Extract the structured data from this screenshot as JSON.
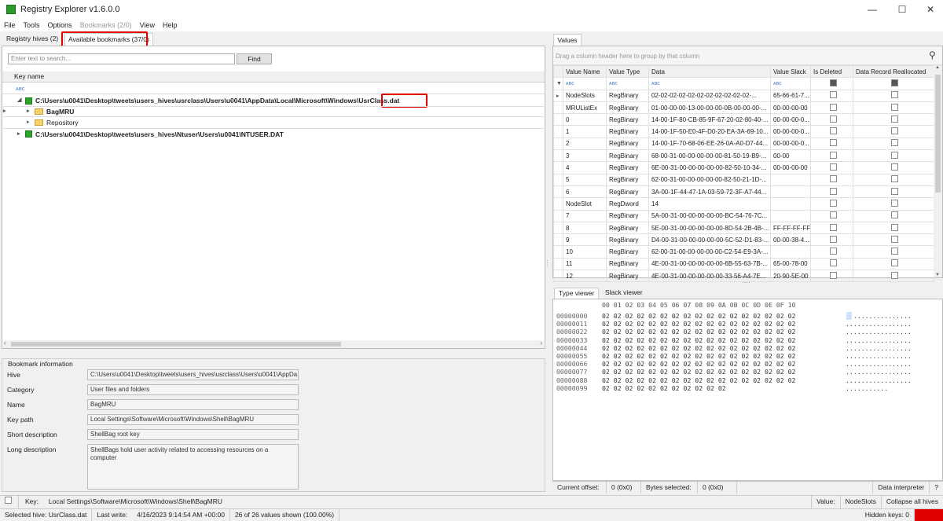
{
  "window": {
    "title": "Registry Explorer v1.6.0.0",
    "min": "—",
    "max": "☐",
    "close": "✕"
  },
  "menu": [
    "File",
    "Tools",
    "Options",
    "Bookmarks (2/0)",
    "View",
    "Help"
  ],
  "left_tabs": {
    "hives": "Registry hives (2)",
    "bookmarks": "Available bookmarks (37/0)"
  },
  "search": {
    "placeholder": "Enter text to search...",
    "find": "Find"
  },
  "tree": {
    "header": "Key name",
    "filter": "ᴀʙc",
    "rows": [
      {
        "text": "C:\\Users\\u0041\\Desktop\\tweets\\users_hives\\usrclass\\Users\\u0041\\AppData\\Local\\Microsoft\\Windows\\",
        "highlight": "UsrClass.dat"
      },
      {
        "text": "BagMRU"
      },
      {
        "text": "Repository"
      },
      {
        "text": "C:\\Users\\u0041\\Desktop\\tweets\\users_hives\\Ntuser\\Users\\u0041\\NTUSER.DAT"
      }
    ]
  },
  "bookmark_info": {
    "title": "Bookmark information",
    "fields": [
      {
        "label": "Hive",
        "value": "C:\\Users\\u0041\\Desktop\\tweets\\users_hives\\usrclass\\Users\\u0041\\AppDa"
      },
      {
        "label": "Category",
        "value": "User files and folders"
      },
      {
        "label": "Name",
        "value": "BagMRU"
      },
      {
        "label": "Key path",
        "value": "Local Settings\\Software\\Microsoft\\Windows\\Shell\\BagMRU"
      },
      {
        "label": "Short description",
        "value": "ShellBag root key"
      },
      {
        "label": "Long description",
        "value": "ShellBags hold user activity related to accessing resources on a computer"
      }
    ]
  },
  "values": {
    "tab": "Values",
    "group_hint": "Drag a column header here to group by that column",
    "columns": [
      "Value Name",
      "Value Type",
      "Data",
      "Value Slack",
      "Is Deleted",
      "Data Record Reallocated"
    ],
    "rows": [
      [
        "NodeSlots",
        "RegBinary",
        "02-02-02-02-02-02-02-02-02-02-02-...",
        "65-66-61-7..."
      ],
      [
        "MRUListEx",
        "RegBinary",
        "01-00-00-00-13-00-00-00-0B-00-00-00-...",
        "00-00-00-00"
      ],
      [
        "0",
        "RegBinary",
        "14-00-1F-80-CB-85-9F-67-20-02-80-40-...",
        "00-00-00-0..."
      ],
      [
        "1",
        "RegBinary",
        "14-00-1F-50-E0-4F-D0-20-EA-3A-69-10...",
        "00-00-00-0..."
      ],
      [
        "2",
        "RegBinary",
        "14-00-1F-70-68-06-EE-26-0A-A0-D7-44...",
        "00-00-00-0..."
      ],
      [
        "3",
        "RegBinary",
        "68-00-31-00-00-00-00-00-81-50-19-B9-...",
        "00-00"
      ],
      [
        "4",
        "RegBinary",
        "6E-00-31-00-00-00-00-00-82-50-10-34-...",
        "00-00-00-00"
      ],
      [
        "5",
        "RegBinary",
        "62-00-31-00-00-00-00-00-82-50-21-1D-...",
        ""
      ],
      [
        "6",
        "RegBinary",
        "3A-00-1F-44-47-1A-03-59-72-3F-A7-44...",
        ""
      ],
      [
        "NodeSlot",
        "RegDword",
        "14",
        ""
      ],
      [
        "7",
        "RegBinary",
        "5A-00-31-00-00-00-00-00-BC-54-76-7C...",
        ""
      ],
      [
        "8",
        "RegBinary",
        "5E-00-31-00-00-00-00-00-8D-54-2B-4B-...",
        "FF-FF-FF-FF"
      ],
      [
        "9",
        "RegBinary",
        "D4-00-31-00-00-00-00-00-5C-52-D1-83-...",
        "00-00-38-4..."
      ],
      [
        "10",
        "RegBinary",
        "62-00-31-00-00-00-00-00-C2-54-E9-3A-...",
        ""
      ],
      [
        "11",
        "RegBinary",
        "4E-00-31-00-00-00-00-00-6B-55-63-7B-...",
        "65-00-78-00"
      ],
      [
        "12",
        "RegBinary",
        "4E-00-31-00-00-00-00-00-33-56-A4-7E...",
        "20-90-5E-00"
      ]
    ]
  },
  "viewer": {
    "tabs": [
      "Type viewer",
      "Slack viewer"
    ],
    "header": "00 01 02 03 04 05 06 07 08 09 0A 0B 0C 0D 0E 0F 10",
    "lines": [
      {
        "off": "00000000",
        "bytes": "02 02 02 02 02 02 02 02 02 02 02 02 02 02 02 02 02",
        "ascii": "................."
      },
      {
        "off": "00000011",
        "bytes": "02 02 02 02 02 02 02 02 02 02 02 02 02 02 02 02 02",
        "ascii": "................."
      },
      {
        "off": "00000022",
        "bytes": "02 02 02 02 02 02 02 02 02 02 02 02 02 02 02 02 02",
        "ascii": "................."
      },
      {
        "off": "00000033",
        "bytes": "02 02 02 02 02 02 02 02 02 02 02 02 02 02 02 02 02",
        "ascii": "................."
      },
      {
        "off": "00000044",
        "bytes": "02 02 02 02 02 02 02 02 02 02 02 02 02 02 02 02 02",
        "ascii": "................."
      },
      {
        "off": "00000055",
        "bytes": "02 02 02 02 02 02 02 02 02 02 02 02 02 02 02 02 02",
        "ascii": "................."
      },
      {
        "off": "00000066",
        "bytes": "02 02 02 02 02 02 02 02 02 02 02 02 02 02 02 02 02",
        "ascii": "................."
      },
      {
        "off": "00000077",
        "bytes": "02 02 02 02 02 02 02 02 02 02 02 02 02 02 02 02 02",
        "ascii": "................."
      },
      {
        "off": "00000088",
        "bytes": "02 02 02 02 02 02 02 02 02 02 02 02 02 02 02 02 02",
        "ascii": "................."
      },
      {
        "off": "00000099",
        "bytes": "02 02 02 02 02 02 02 02 02 02 02",
        "ascii": "..........."
      }
    ],
    "footer": {
      "offset_label": "Current offset:",
      "offset": "0 (0x0)",
      "bytes_label": "Bytes selected:",
      "bytes": "0 (0x0)",
      "interp": "Data interpreter",
      "help": "?"
    }
  },
  "status1": {
    "key_label": "Key:",
    "key": "Local Settings\\Software\\Microsoft\\Windows\\Shell\\BagMRU",
    "value_label": "Value:",
    "value": "NodeSlots",
    "collapse": "Collapse all hives"
  },
  "status2": {
    "hive": "Selected hive: UsrClass.dat",
    "last_write_label": "Last write:",
    "last_write": "4/16/2023 9:14:54 AM +00:00",
    "shown": "26 of 26 values shown (100.00%)",
    "hidden": "Hidden keys: 0"
  },
  "colors": {
    "highlight": "#e00000",
    "accent": "#2e9a2e"
  }
}
